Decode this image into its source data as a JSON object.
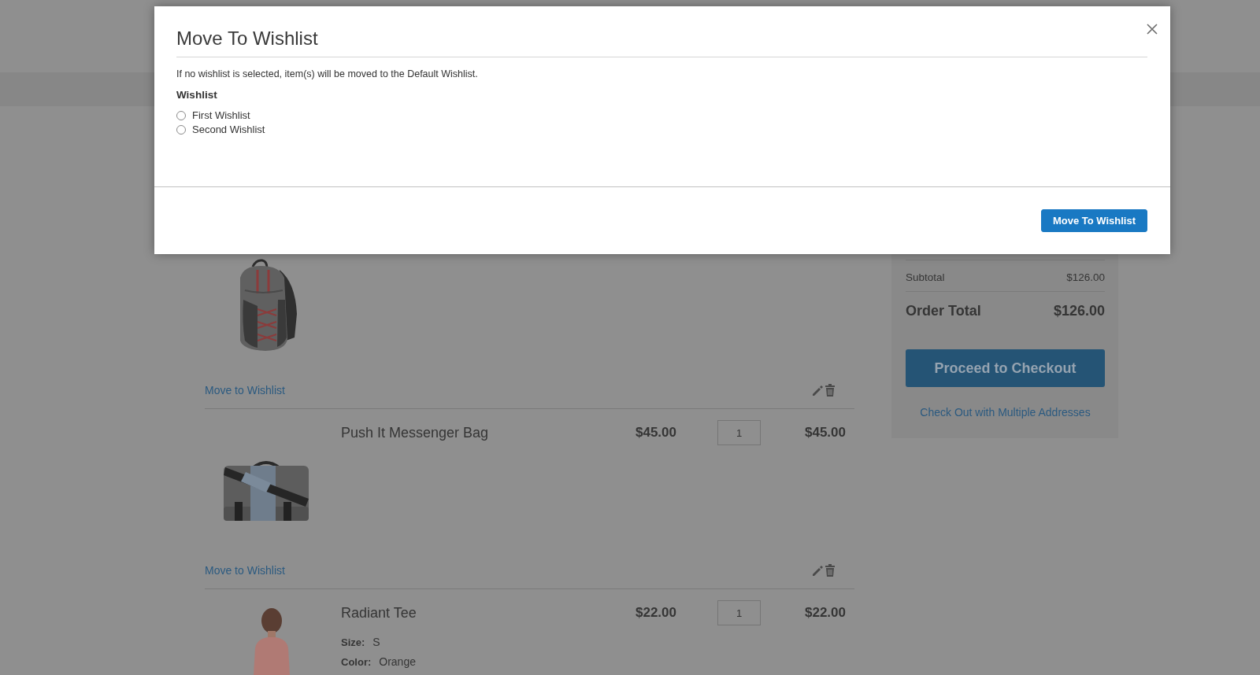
{
  "modal": {
    "title": "Move To Wishlist",
    "note": "If no wishlist is selected, item(s) will be moved to the Default Wishlist.",
    "field_label": "Wishlist",
    "options": [
      {
        "label": "First Wishlist",
        "selected": false
      },
      {
        "label": "Second Wishlist",
        "selected": false
      }
    ],
    "button": "Move To Wishlist"
  },
  "cart": {
    "items": [
      {
        "kind": "backpack",
        "link": "Move to Wishlist"
      },
      {
        "kind": "bag",
        "name": "Push It Messenger Bag",
        "price": "$45.00",
        "qty": "1",
        "subtotal": "$45.00",
        "link": "Move to Wishlist"
      },
      {
        "kind": "apparel",
        "name": "Radiant Tee",
        "price": "$22.00",
        "qty": "1",
        "subtotal": "$22.00",
        "options": [
          {
            "label": "Size:",
            "value": "S"
          },
          {
            "label": "Color:",
            "value": "Orange"
          }
        ]
      }
    ]
  },
  "summary": {
    "totals": [
      {
        "kind": "subtotal",
        "label": "Subtotal",
        "value": "$126.00"
      },
      {
        "kind": "grand_total",
        "label": "Order Total",
        "value": "$126.00"
      }
    ],
    "checkout_button": "Proceed to Checkout",
    "multishipping_link": "Check Out with Multiple Addresses"
  }
}
